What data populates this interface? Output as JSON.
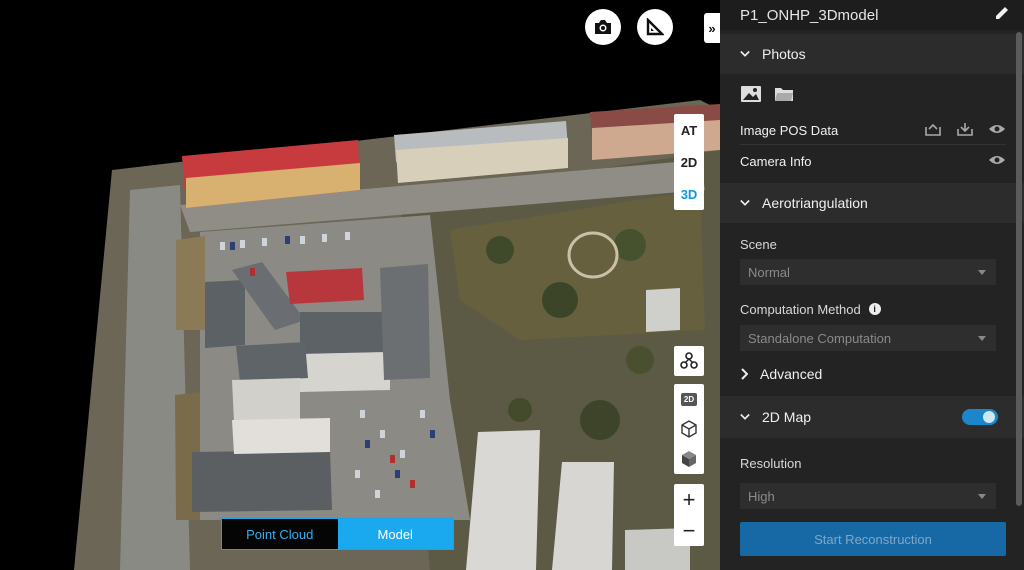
{
  "viewport": {
    "view_modes": [
      "AT",
      "2D",
      "3D"
    ],
    "active_view_mode": "3D",
    "toolbar_icons": [
      "camera-icon",
      "measure-ruler-icon"
    ],
    "collapse_icon": "double-chevron-right-icon",
    "side_tool_icons": [
      "hierarchy-icon",
      "2d-icon",
      "wireframe-cube-icon",
      "solid-cube-icon"
    ],
    "side_tool_2d_label": "2D",
    "zoom_in": "+",
    "zoom_out": "−",
    "display_modes": [
      "Point Cloud",
      "Model"
    ],
    "active_display_mode": "Model"
  },
  "panel": {
    "project_title": "P1_ONHP_3Dmodel",
    "edit_icon": "pencil-icon",
    "photos": {
      "title": "Photos",
      "icons": [
        "image-icon",
        "folder-icon"
      ],
      "image_pos_label": "Image POS Data",
      "image_pos_icons": [
        "import-icon",
        "export-icon",
        "eye-icon"
      ],
      "camera_info_label": "Camera Info"
    },
    "aerotriangulation": {
      "title": "Aerotriangulation",
      "scene_label": "Scene",
      "scene_value": "Normal",
      "computation_label": "Computation Method",
      "computation_value": "Standalone Computation",
      "advanced_label": "Advanced"
    },
    "map2d": {
      "title": "2D Map",
      "enabled": true,
      "resolution_label": "Resolution",
      "resolution_value": "High"
    },
    "start_button": "Start Reconstruction"
  },
  "colors": {
    "accent": "#1aa9ef",
    "panel_bg": "#232323",
    "section_bg": "#2c2c2c",
    "start_button": "#1769a6"
  }
}
